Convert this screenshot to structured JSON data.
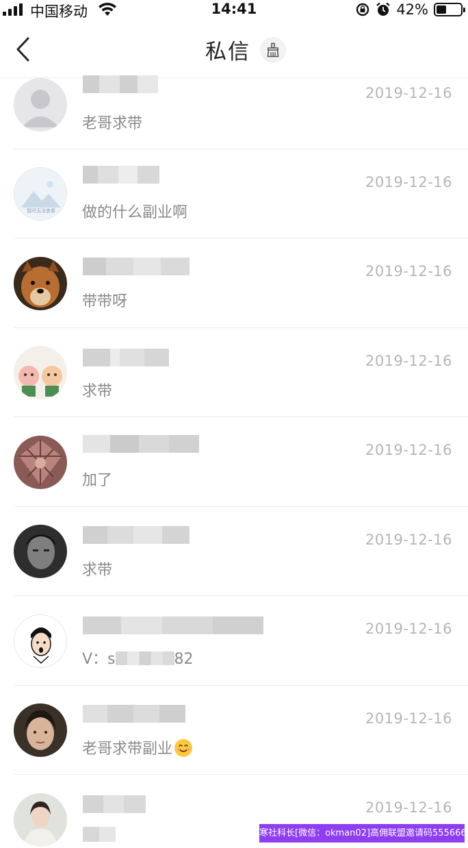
{
  "status_bar": {
    "carrier": "中国移动",
    "time": "14:41",
    "battery_percent": "42%",
    "battery_level": 0.42
  },
  "nav": {
    "title": "私信",
    "back_icon": "chevron-left-icon",
    "clean_icon": "broom-icon"
  },
  "messages": [
    {
      "message": "老哥求带",
      "date": "2019-12-16",
      "avatar": "default-avatar"
    },
    {
      "message": "做的什么副业啊",
      "date": "2019-12-16",
      "avatar": "image-unavailable-avatar",
      "avatar_caption": "暂时无法查看"
    },
    {
      "message": "带带呀",
      "date": "2019-12-16",
      "avatar": "dog-avatar"
    },
    {
      "message": "求带",
      "date": "2019-12-16",
      "avatar": "cartoon-pigs-avatar"
    },
    {
      "message": "加了",
      "date": "2019-12-16",
      "avatar": "gem-avatar"
    },
    {
      "message": "求带",
      "date": "2019-12-16",
      "avatar": "man-portrait-avatar"
    },
    {
      "message_prefix": "V：s",
      "message_suffix": "82",
      "date": "2019-12-16",
      "avatar": "cartoon-face-avatar"
    },
    {
      "message": "老哥求带副业",
      "date": "2019-12-16",
      "avatar": "woman-portrait-avatar",
      "emoji": "smiling-face-emoji"
    },
    {
      "message": "",
      "date": "2019-12-16",
      "avatar": "lady-portrait-avatar"
    }
  ],
  "watermark": {
    "text": "寒社科长[微信：okman02]高佣联盟邀请码555666"
  },
  "colors": {
    "accent_watermark": "#8e3df0",
    "date_text": "#b5b5b5",
    "message_text": "#8a8a8a"
  }
}
